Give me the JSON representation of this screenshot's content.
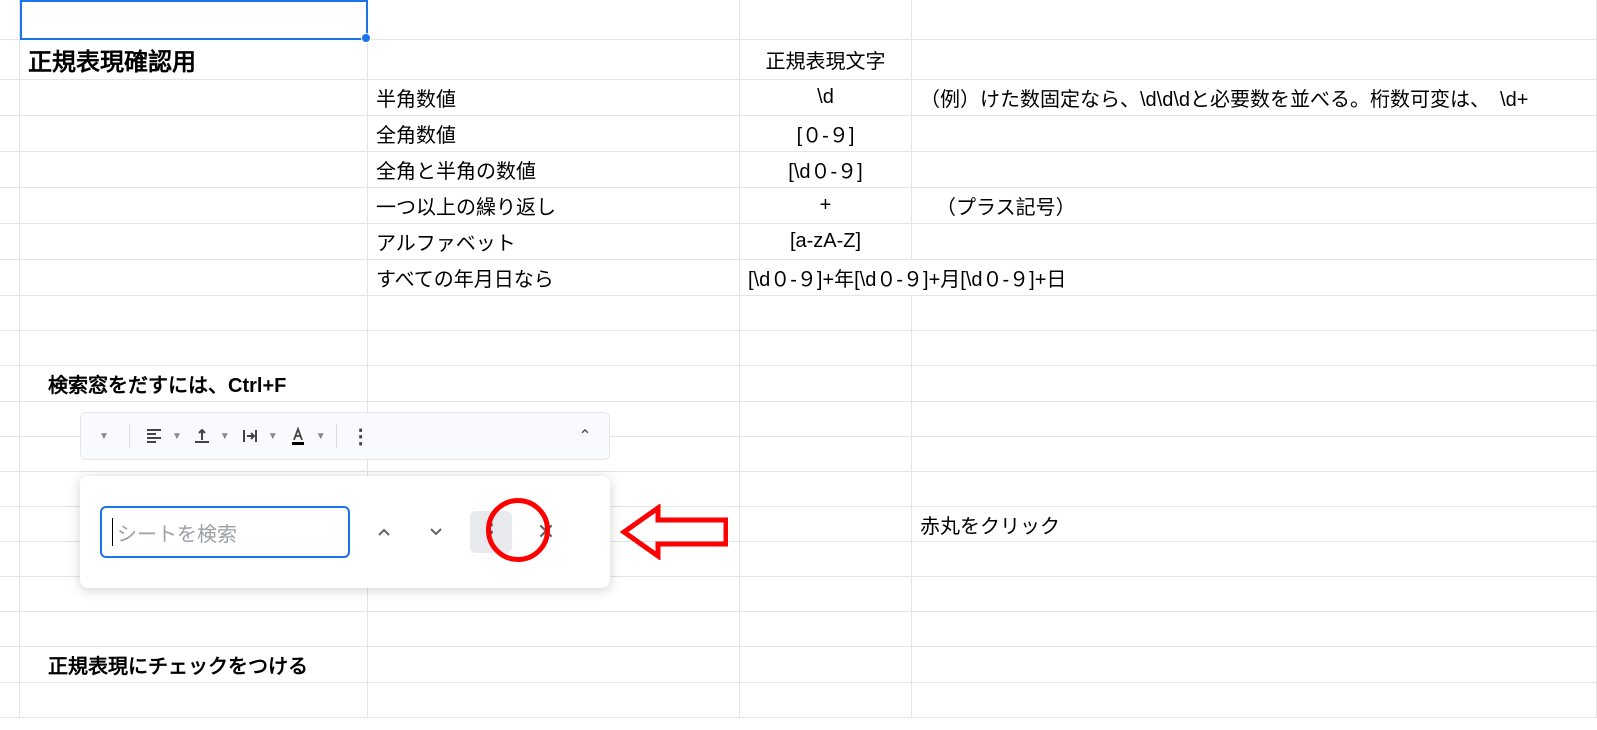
{
  "title_cell": "正規表現確認用",
  "header_D": "正規表現文字",
  "rows": [
    {
      "c": "半角数値",
      "d": "\\d",
      "e": "（例）けた数固定なら、\\d\\d\\dと必要数を並べる。桁数可変は、　\\d+"
    },
    {
      "c": "全角数値",
      "d": "[０-９]",
      "e": ""
    },
    {
      "c": "全角と半角の数値",
      "d": "[\\d０-９]",
      "e": ""
    },
    {
      "c": "一つ以上の繰り返し",
      "d": "+",
      "e": "（プラス記号）"
    },
    {
      "c": "アルファベット",
      "d": "[a-zA-Z]",
      "e": ""
    },
    {
      "c": "すべての年月日なら",
      "de": "[\\d０-９]+年[\\d０-９]+月[\\d０-９]+日"
    }
  ],
  "row_search_hint": "検索窓をだすには、Ctrl+F",
  "row_click_red": "赤丸をクリック",
  "row_regex_check": "正規表現にチェックをつける",
  "search": {
    "placeholder": "シートを検索"
  },
  "toolbar": {
    "align": "align-icon",
    "valign": "valign-icon",
    "wrap": "wrap-icon",
    "textcolor": "textcolor-icon",
    "more": "⋮",
    "collapse": "^"
  }
}
